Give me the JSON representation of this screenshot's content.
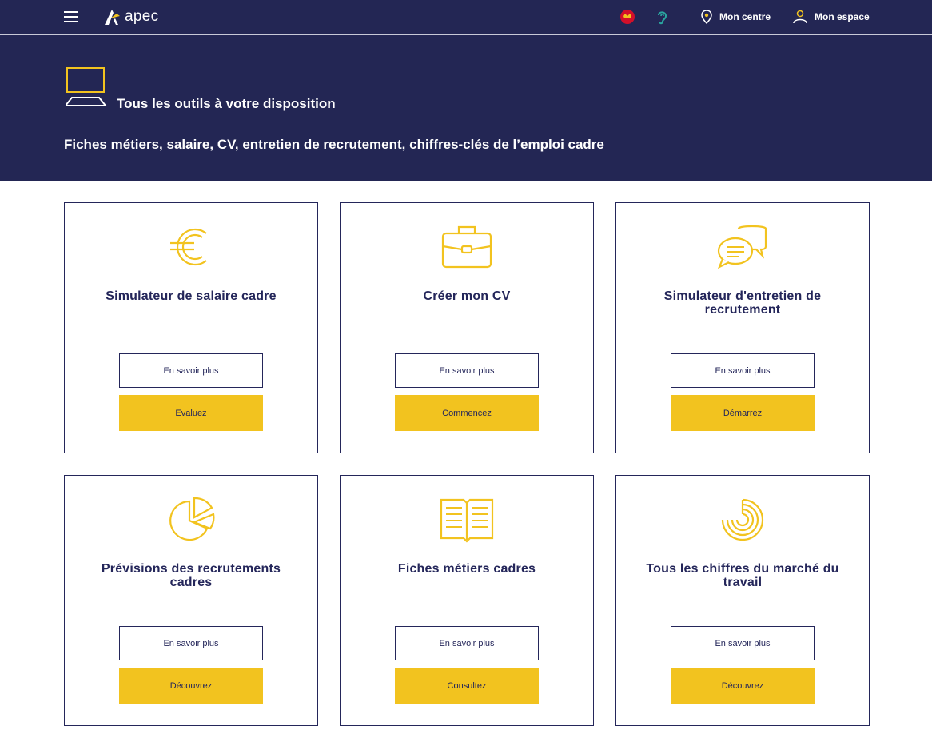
{
  "header": {
    "logo_text": "apec",
    "nav": [
      {
        "label": "Mon centre",
        "icon": "location-pin-icon"
      },
      {
        "label": "Mon espace",
        "icon": "user-icon"
      }
    ],
    "icons": [
      "menu-icon",
      "accessibility-icon",
      "hearing-icon"
    ]
  },
  "hero": {
    "title": "Tous les outils à votre disposition",
    "subtitle": "Fiches métiers, salaire, CV, entretien de recrutement, chiffres-clés de l’emploi cadre"
  },
  "colors": {
    "navy": "#232654",
    "yellow": "#f2c31f",
    "white": "#ffffff"
  },
  "cards": [
    {
      "title": "Simulateur de salaire cadre",
      "icon": "euro-icon",
      "secondary": "En savoir plus",
      "primary": "Evaluez"
    },
    {
      "title": "Créer mon CV",
      "icon": "briefcase-icon",
      "secondary": "En savoir plus",
      "primary": "Commencez"
    },
    {
      "title": "Simulateur d'entretien de recrutement",
      "icon": "chat-bubbles-icon",
      "secondary": "En savoir plus",
      "primary": "Démarrez"
    },
    {
      "title": "Prévisions des recrutements cadres",
      "icon": "pie-chart-icon",
      "secondary": "En savoir plus",
      "primary": "Découvrez"
    },
    {
      "title": "Fiches métiers cadres",
      "icon": "open-book-icon",
      "secondary": "En savoir plus",
      "primary": "Consultez"
    },
    {
      "title": "Tous les chiffres du marché du travail",
      "icon": "spiral-chart-icon",
      "secondary": "En savoir plus",
      "primary": "Découvrez"
    }
  ]
}
